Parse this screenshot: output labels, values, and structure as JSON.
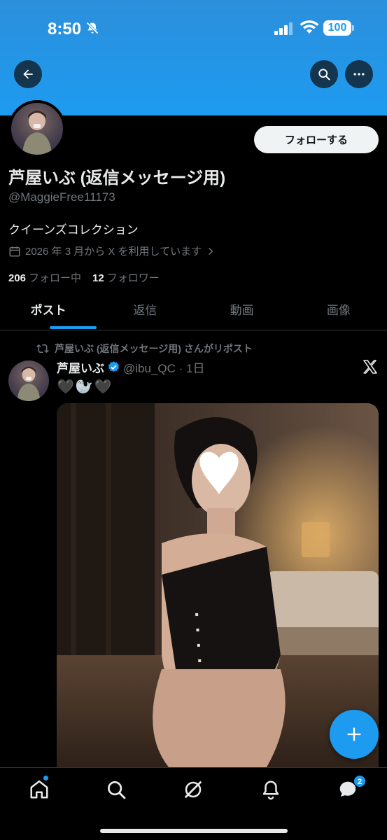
{
  "status_bar": {
    "time": "8:50",
    "battery": "100"
  },
  "profile": {
    "display_name": "芦屋いぶ (返信メッセージ用)",
    "handle": "@MaggieFree11173",
    "bio": "クイーンズコレクション",
    "joined": "2026 年 3 月から X を利用しています",
    "following_count": "206",
    "following_label": "フォロー中",
    "followers_count": "12",
    "followers_label": "フォロワー",
    "follow_button": "フォローする"
  },
  "tabs": [
    {
      "label": "ポスト",
      "active": true
    },
    {
      "label": "返信",
      "active": false
    },
    {
      "label": "動画",
      "active": false
    },
    {
      "label": "画像",
      "active": false
    }
  ],
  "post": {
    "repost_label": "芦屋いぶ (返信メッセージ用) さんがリポスト",
    "author": "芦屋いぶ",
    "meta": "@ibu_QC · 1日",
    "text": "🖤🦭🖤"
  },
  "bottom_nav": {
    "items": [
      "home-icon",
      "search-icon",
      "grok-icon",
      "notifications-icon",
      "messages-icon"
    ],
    "messages_badge": "2"
  },
  "colors": {
    "accent": "#1d9bf0",
    "background": "#000000",
    "muted": "#71767b"
  }
}
